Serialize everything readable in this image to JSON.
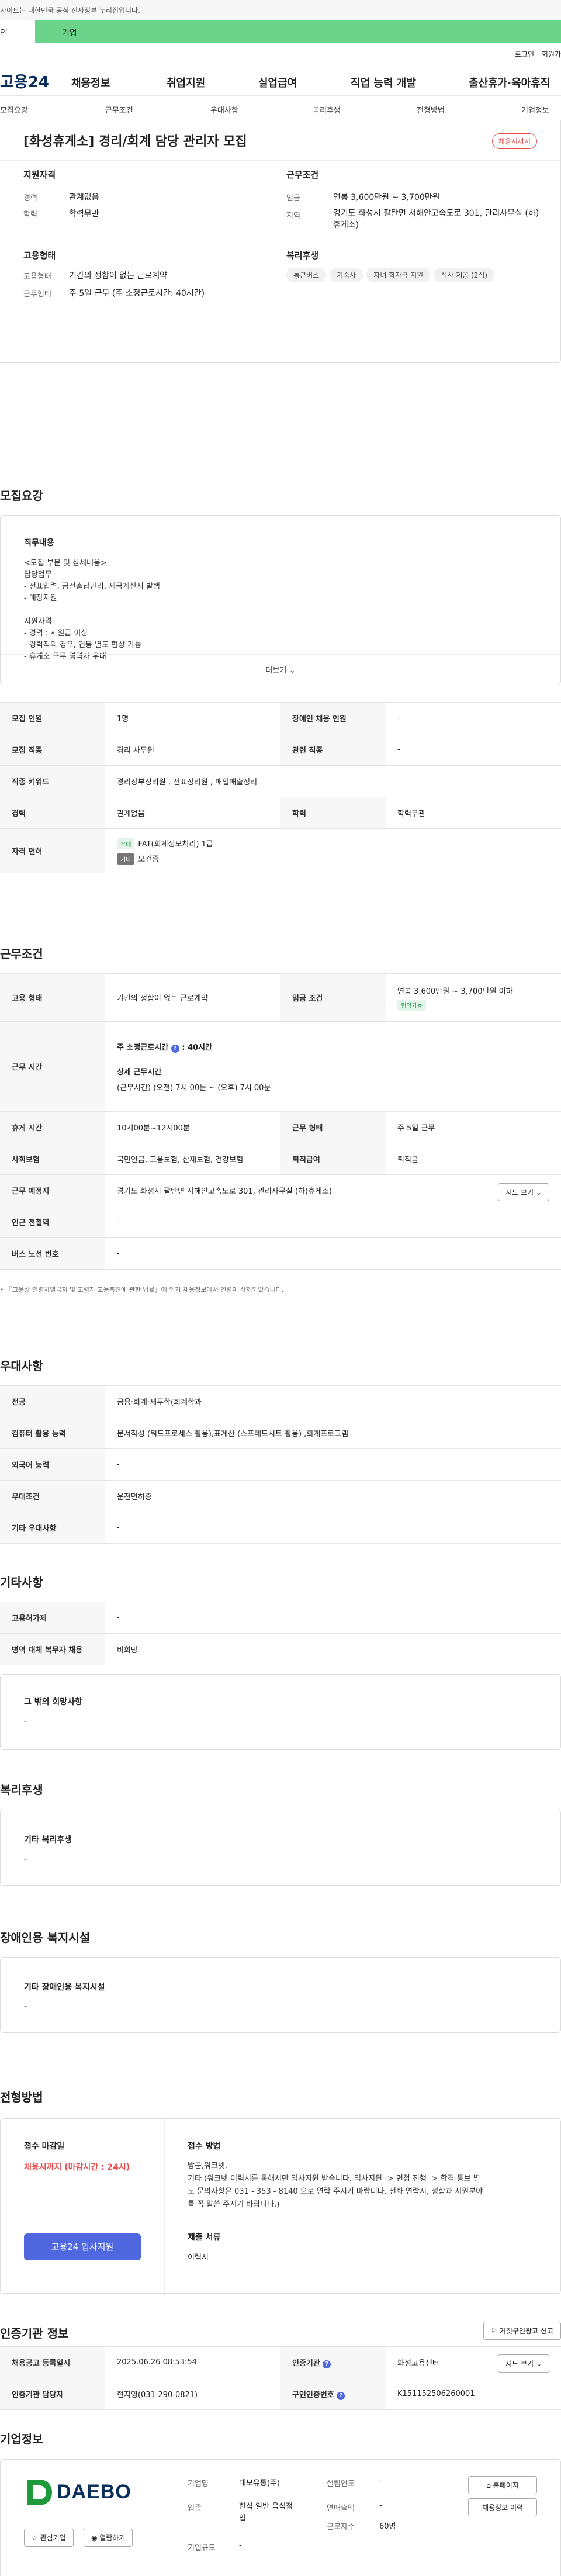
{
  "gov_bar": {
    "text": "사이트는 대한민국 공식 전자정부 누리집입니다."
  },
  "top_tabs": {
    "personal": "인",
    "company": "기업"
  },
  "util": {
    "login": "로그인",
    "join": "회원가"
  },
  "gnb": {
    "logo": "고용24",
    "menus": [
      "채용정보",
      "취업지원",
      "실업급여",
      "직업 능력 개발",
      "출산휴가·육아휴직"
    ]
  },
  "subnav": [
    "모집요강",
    "근무조건",
    "우대사항",
    "복리후생",
    "전형방법",
    "기업정보"
  ],
  "summary": {
    "title": "[화성휴게소] 경리/회계 담당 관리자 모집",
    "status": "채용시까지",
    "qual": {
      "heading": "지원자격",
      "rows": [
        {
          "k": "경력",
          "v": "관계없음"
        },
        {
          "k": "학력",
          "v": "학력무관"
        }
      ]
    },
    "cond": {
      "heading": "근무조건",
      "rows": [
        {
          "k": "임금",
          "v": "연봉 3,600만원 ~ 3,700만원"
        },
        {
          "k": "지역",
          "v": "경기도 화성시 팔탄면 서해안고속도로 301, 관리사무실 (하)휴게소)"
        }
      ]
    },
    "employ": {
      "heading": "고용형태",
      "rows": [
        {
          "k": "고용형태",
          "v": "기간의 정함이 없는 근로계약"
        },
        {
          "k": "근무형태",
          "v": "주 5일 근무 (주 소정근로시간: 40시간)"
        }
      ]
    },
    "welfare": {
      "heading": "복리후생",
      "chips": [
        "통근버스",
        "기숙사",
        "자녀 학자금 지원",
        "식사 제공 (2식)"
      ]
    }
  },
  "recruit": {
    "heading": "모집요강",
    "job_label": "직무내용",
    "job_lines": [
      "<모집 부문 및 상세내용>",
      "담당업무",
      "- 전표입력, 금전출납관리, 세금계산서 발행",
      "- 매장지원",
      "",
      "지원자격",
      "- 경력 : 사원급 이상",
      "- 경력직의 경우, 연봉 별도 협상 가능",
      "- 휴게소 근무 경력자 우대"
    ],
    "more": "더보기",
    "table": {
      "headcount_k": "모집 인원",
      "headcount_v": "1명",
      "disabled_k": "장애인 채용 인원",
      "disabled_v": "-",
      "job_k": "모집 직종",
      "job_v": "경리 사무원",
      "rel_k": "관련 직종",
      "rel_v": "-",
      "kw_k": "직종 키워드",
      "kw_v": "경리장부정리원 , 전표정리원 , 매입매출정리",
      "career_k": "경력",
      "career_v": "관계없음",
      "edu_k": "학력",
      "edu_v": "학력무관",
      "license_k": "자격 면허",
      "license": [
        {
          "tag": "우대",
          "v": "FAT(회계정보처리) 1급"
        },
        {
          "tag": "기타",
          "v": "보건증"
        }
      ]
    }
  },
  "work": {
    "heading": "근무조건",
    "type_k": "고용 형태",
    "type_v": "기간의 정함이 없는 근로계약",
    "wage_k": "임금 조건",
    "wage_v": "연봉 3,600만원 ~ 3,700만원 이하",
    "wage_tag": "협의가능",
    "hours_k": "근무 시간",
    "hours_main": "주 소정근로시간",
    "hours_main_v": ": 40시간",
    "hours_detail_h": "상세 근무시간",
    "hours_detail_v": "(근무시간) (오전) 7시 00분 ~ (오후) 7시 00분",
    "rest_k": "휴게 시간",
    "rest_v": "10시00분~12시00분",
    "form_k": "근무 형태",
    "form_v": "주 5일 근무",
    "ins_k": "사회보험",
    "ins_v": "국민연금, 고용보험, 산재보험, 건강보험",
    "sev_k": "퇴직급여",
    "sev_v": "퇴직금",
    "place_k": "근무 예정지",
    "place_v": "경기도 화성시 팔탄면 서해안고속도로 301, 관리사무실 (하)휴게소)",
    "map_btn": "지도 보기",
    "station_k": "인근 전철역",
    "station_v": "-",
    "bus_k": "버스 노선 번호",
    "bus_v": "-",
    "note": "• 『고용상 연령차별금지 및 고령자 고용촉진에 관한 법률』에 의거 채용정보에서 연령이 삭제되었습니다."
  },
  "pref": {
    "heading": "우대사항",
    "rows": [
      {
        "k": "전공",
        "v": "금융·회계·세무학(회계학과"
      },
      {
        "k": "컴퓨터 활용 능력",
        "v": "문서작성 (워드프로세스 활용),표계산 (스프레드시트 활용) ,회계프로그램"
      },
      {
        "k": "외국어 능력",
        "v": "-"
      },
      {
        "k": "우대조건",
        "v": "운전면허증"
      },
      {
        "k": "기타 우대사항",
        "v": "-"
      }
    ]
  },
  "etc": {
    "heading": "기타사항",
    "rows": [
      {
        "k": "고용허가제",
        "v": "-"
      },
      {
        "k": "병역 대체 복무자 채용",
        "v": "비희망"
      }
    ],
    "other_label": "그 밖의 희망사항",
    "other_v": "-"
  },
  "benefit": {
    "heading": "복리후생",
    "label": "기타 복리후생",
    "v": "-"
  },
  "disab": {
    "heading": "장애인용 복지시설",
    "label": "기타 장애인용 복지시설",
    "v": "-"
  },
  "process": {
    "heading": "전형방법",
    "deadline_label": "접수 마감일",
    "deadline_v": "채용시까지 (마감시간 : 24시)",
    "apply_btn": "고용24 입사지원",
    "method_label": "접수 방법",
    "method_lines": [
      "방문,워크넷,",
      "기타 (워크넷 이력서를 통해서만 입사지원 받습니다.  입사지원 -> 면접 진행 -> 합격 통보 별",
      "도 문의사항은  031 - 353 - 8140 으로  연락 주시기 바랍니다.  전화 연락시, 성함과 지원분야",
      "를 꼭 말씀 주시기 바랍니다.)"
    ],
    "docs_label": "제출 서류",
    "docs_v": "이력서"
  },
  "auth": {
    "heading": "인증기관 정보",
    "fraud_btn": "거짓구인광고 신고",
    "reg_k": "채용공고 등록일시",
    "reg_v": "2025.06.26 08:53:54",
    "org_k": "인증기관",
    "org_v": "화성고용센터",
    "map_btn": "지도 보기",
    "mgr_k": "인증기관 담당자",
    "mgr_v": "현지영(031-290-0821)",
    "id_k": "구인인증번호",
    "id_v": "K151152506260001"
  },
  "company": {
    "heading": "기업정보",
    "logo_text": "DAEBO",
    "fav_btn": "관심기업",
    "follow_btn": "열람하기",
    "name_k": "기업명",
    "name_v": "대보유통(주)",
    "found_k": "설립연도",
    "found_v": "-",
    "ind_k": "업종",
    "ind_v1": "한식 일반 음식점",
    "ind_v2": "업",
    "sales_k": "연매출액",
    "sales_v": "-",
    "emp_k": "근로자수",
    "emp_v": "60명",
    "scale_k": "기업규모",
    "scale_v": "-",
    "home_btn": "홈페이지",
    "history_btn": "채용정보 이력"
  },
  "colors": {
    "accent": "#4f68e0",
    "green": "#6bd38a",
    "red": "#e94c4c",
    "navy": "#0a2f5c",
    "logo_green": "#1f9a3a"
  }
}
